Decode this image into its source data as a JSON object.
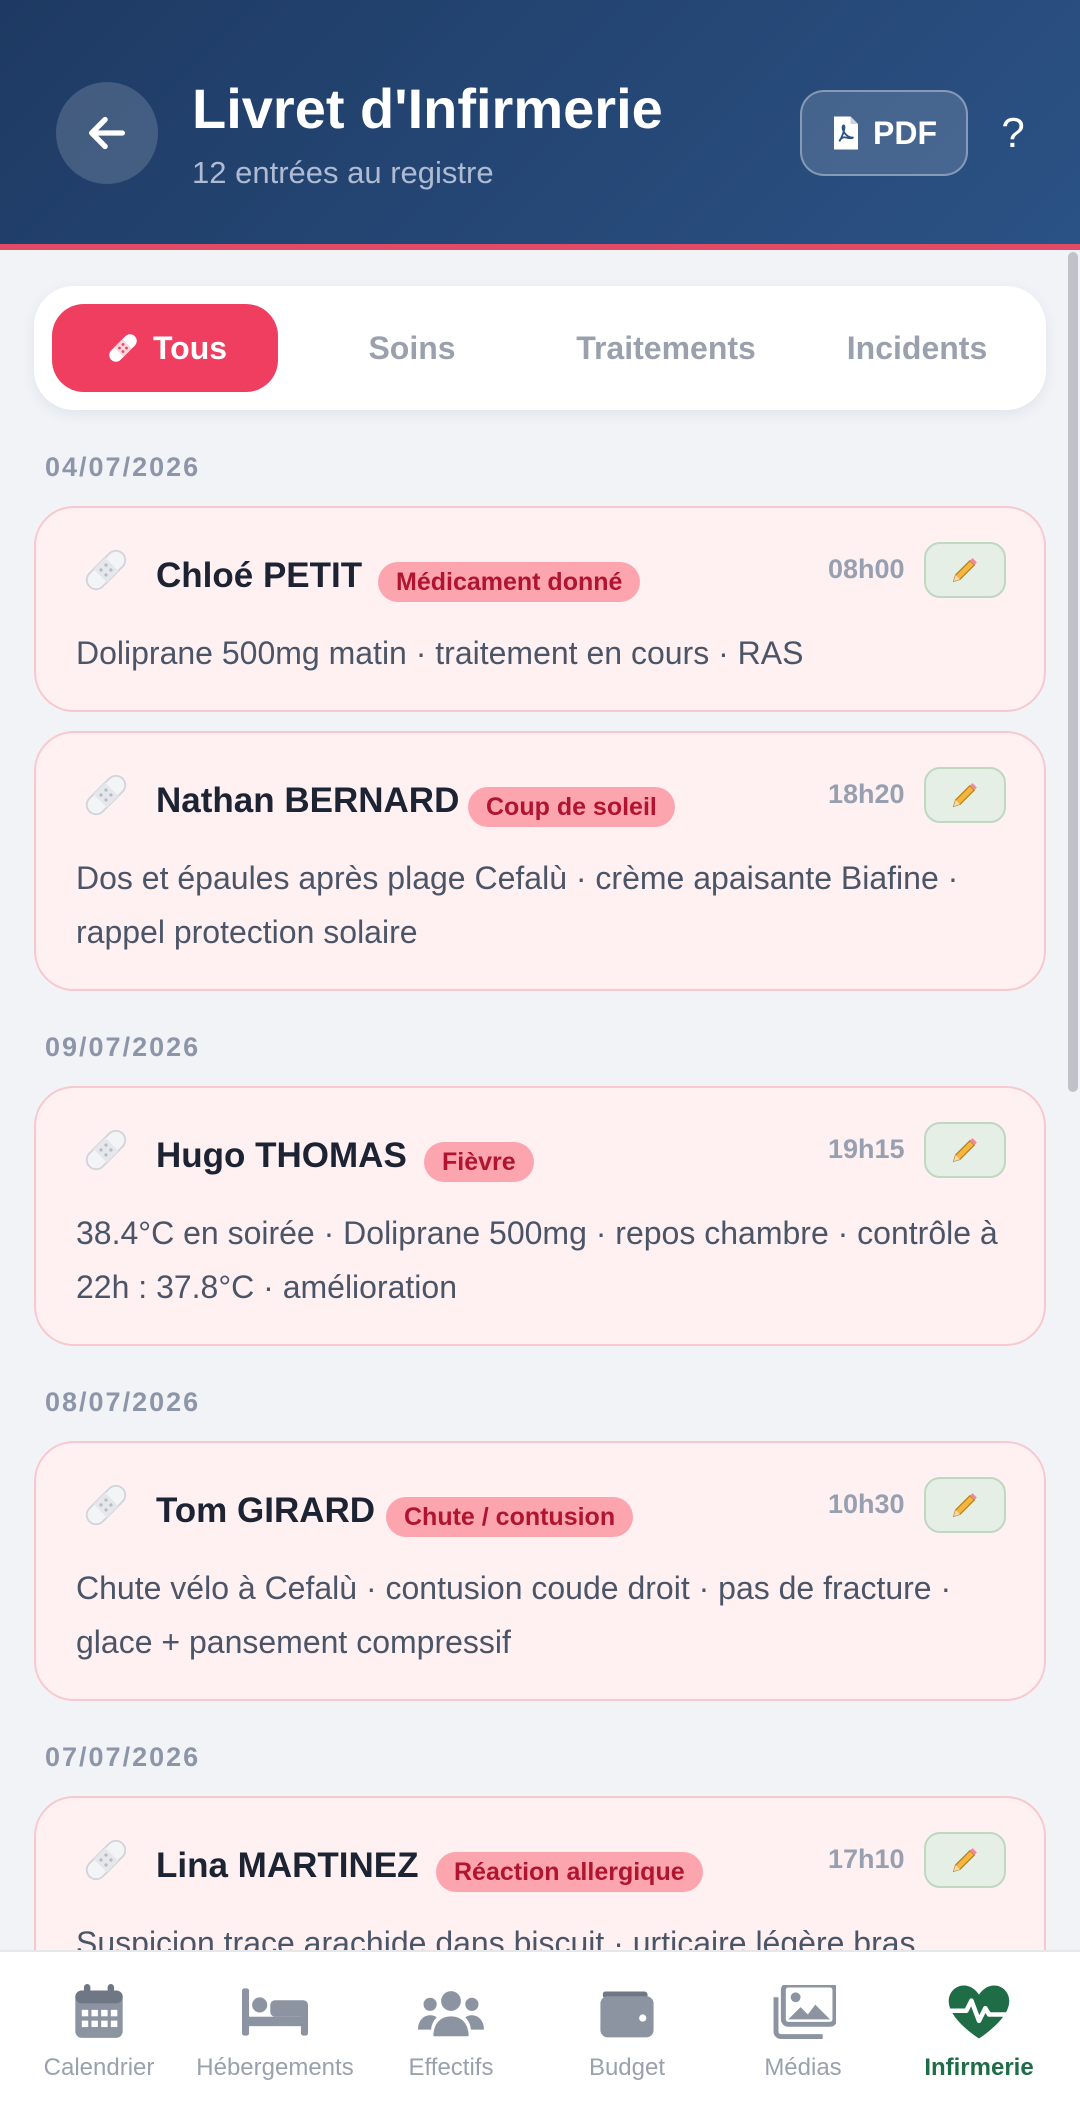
{
  "header": {
    "title": "Livret d'Infirmerie",
    "subtitle": "12 entrées au registre",
    "pdf_label": "PDF",
    "help_label": "?"
  },
  "tabs": [
    {
      "label": "Tous",
      "active": true
    },
    {
      "label": "Soins",
      "active": false
    },
    {
      "label": "Traitements",
      "active": false
    },
    {
      "label": "Incidents",
      "active": false
    }
  ],
  "groups": [
    {
      "date": "04/07/2026",
      "entries": [
        {
          "name": "Chloé PETIT",
          "badge": "Médicament donné",
          "time": "08h00",
          "text": "Doliprane 500mg matin · traitement en cours · RAS"
        },
        {
          "name": "Nathan BERNARD",
          "badge": "Coup de soleil",
          "time": "18h20",
          "text": "Dos et épaules après plage Cefalù · crème apaisante Biafine · rappel protection solaire"
        }
      ]
    },
    {
      "date": "09/07/2026",
      "entries": [
        {
          "name": "Hugo THOMAS",
          "badge": "Fièvre",
          "time": "19h15",
          "text": "38.4°C en soirée · Doliprane 500mg · repos chambre · contrôle à 22h : 37.8°C · amélioration"
        }
      ]
    },
    {
      "date": "08/07/2026",
      "entries": [
        {
          "name": "Tom GIRARD",
          "badge": "Chute / contusion",
          "time": "10h30",
          "text": "Chute vélo à Cefalù · contusion coude droit · pas de fracture · glace + pansement compressif"
        }
      ]
    },
    {
      "date": "07/07/2026",
      "entries": [
        {
          "name": "Lina MARTINEZ",
          "badge": "Réaction allergique",
          "time": "17h10",
          "text": "Suspicion trace arachide dans biscuit · urticaire légère bras"
        }
      ]
    }
  ],
  "nav": [
    {
      "label": "Calendrier",
      "icon": "calendar-icon",
      "active": false
    },
    {
      "label": "Hébergements",
      "icon": "bed-icon",
      "active": false
    },
    {
      "label": "Effectifs",
      "icon": "users-icon",
      "active": false
    },
    {
      "label": "Budget",
      "icon": "wallet-icon",
      "active": false
    },
    {
      "label": "Médias",
      "icon": "images-icon",
      "active": false
    },
    {
      "label": "Infirmerie",
      "icon": "heart-pulse-icon",
      "active": true
    }
  ],
  "colors": {
    "header": "#1e3a63",
    "accent": "#ef3e5f",
    "badge_bg": "#fca5ae",
    "badge_text": "#b0142f",
    "nav_active": "#1f6d47"
  }
}
